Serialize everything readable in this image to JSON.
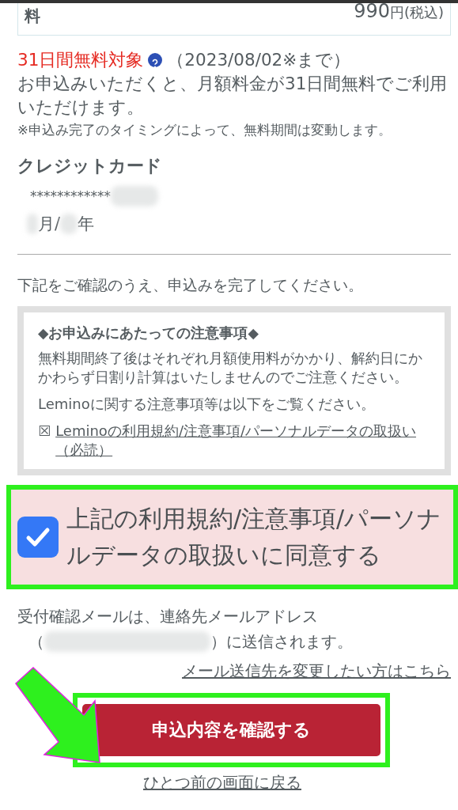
{
  "plan_box": {
    "label": "料",
    "price": "990",
    "unit": "円(税込)"
  },
  "trial": {
    "badge": "31日間無料対象",
    "period": "（2023/08/02※まで）",
    "description": "お申込みいただくと、月額料金が31日間無料でご利用いただけます。",
    "note": "※申込み完了のタイミングによって、無料期間は変動します。"
  },
  "payment": {
    "heading": "クレジットカード",
    "card_number": "************",
    "expiry_parts": [
      "月/",
      "年"
    ]
  },
  "instruction": "下記をご確認のうえ、申込みを完了してください。",
  "notice": {
    "title": "◆お申込みにあたっての注意事項◆",
    "paragraphs": [
      "無料期間終了後はそれぞれ月額使用料がかかり、解約日にかかわらず日割り計算はいたしませんのでご注意ください。",
      "Leminoに関する注意事項等は以下をご覧ください。"
    ],
    "link_mark": "☒",
    "link": "Leminoの利用規約/注意事項/パーソナルデータの取扱い（必読）"
  },
  "agreement": {
    "label": "上記の利用規約/注意事項/パーソナルデータの取扱いに同意する",
    "checked": true
  },
  "email": {
    "text": "受付確認メールは、連絡先メールアドレス",
    "open": "（",
    "close": "）に送信されます。"
  },
  "change_link": "メール送信先を変更したい方はこちら",
  "confirm_button": "申込内容を確認する",
  "back_link": "ひとつ前の画面に戻る"
}
